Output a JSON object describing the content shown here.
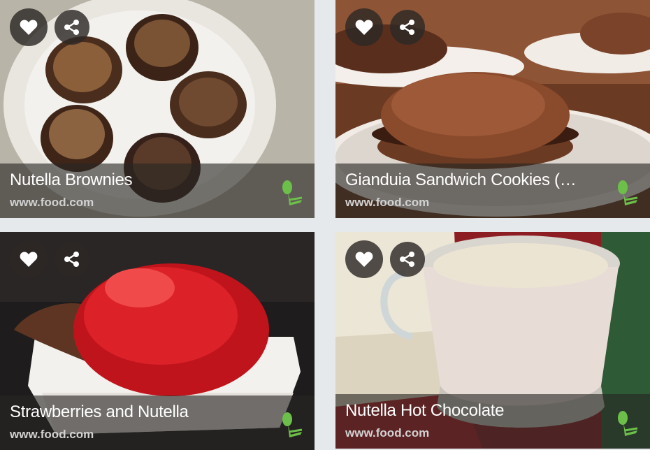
{
  "recipes": [
    {
      "title": "Nutella Brownies",
      "source": "www.food.com"
    },
    {
      "title": "Gianduia Sandwich Cookies (Ch…",
      "source": "www.food.com"
    },
    {
      "title": "Strawberries and Nutella",
      "source": "www.food.com"
    },
    {
      "title": "Nutella Hot Chocolate",
      "source": "www.food.com"
    }
  ],
  "icons": {
    "like": "heart-icon",
    "share": "share-icon",
    "brand": "chef-hat-logo-icon"
  },
  "colors": {
    "background": "#e6e9ec",
    "overlay": "rgba(40,38,36,0.62)",
    "button": "rgba(45,40,38,0.82)",
    "brand_green": "#6cc04a"
  }
}
